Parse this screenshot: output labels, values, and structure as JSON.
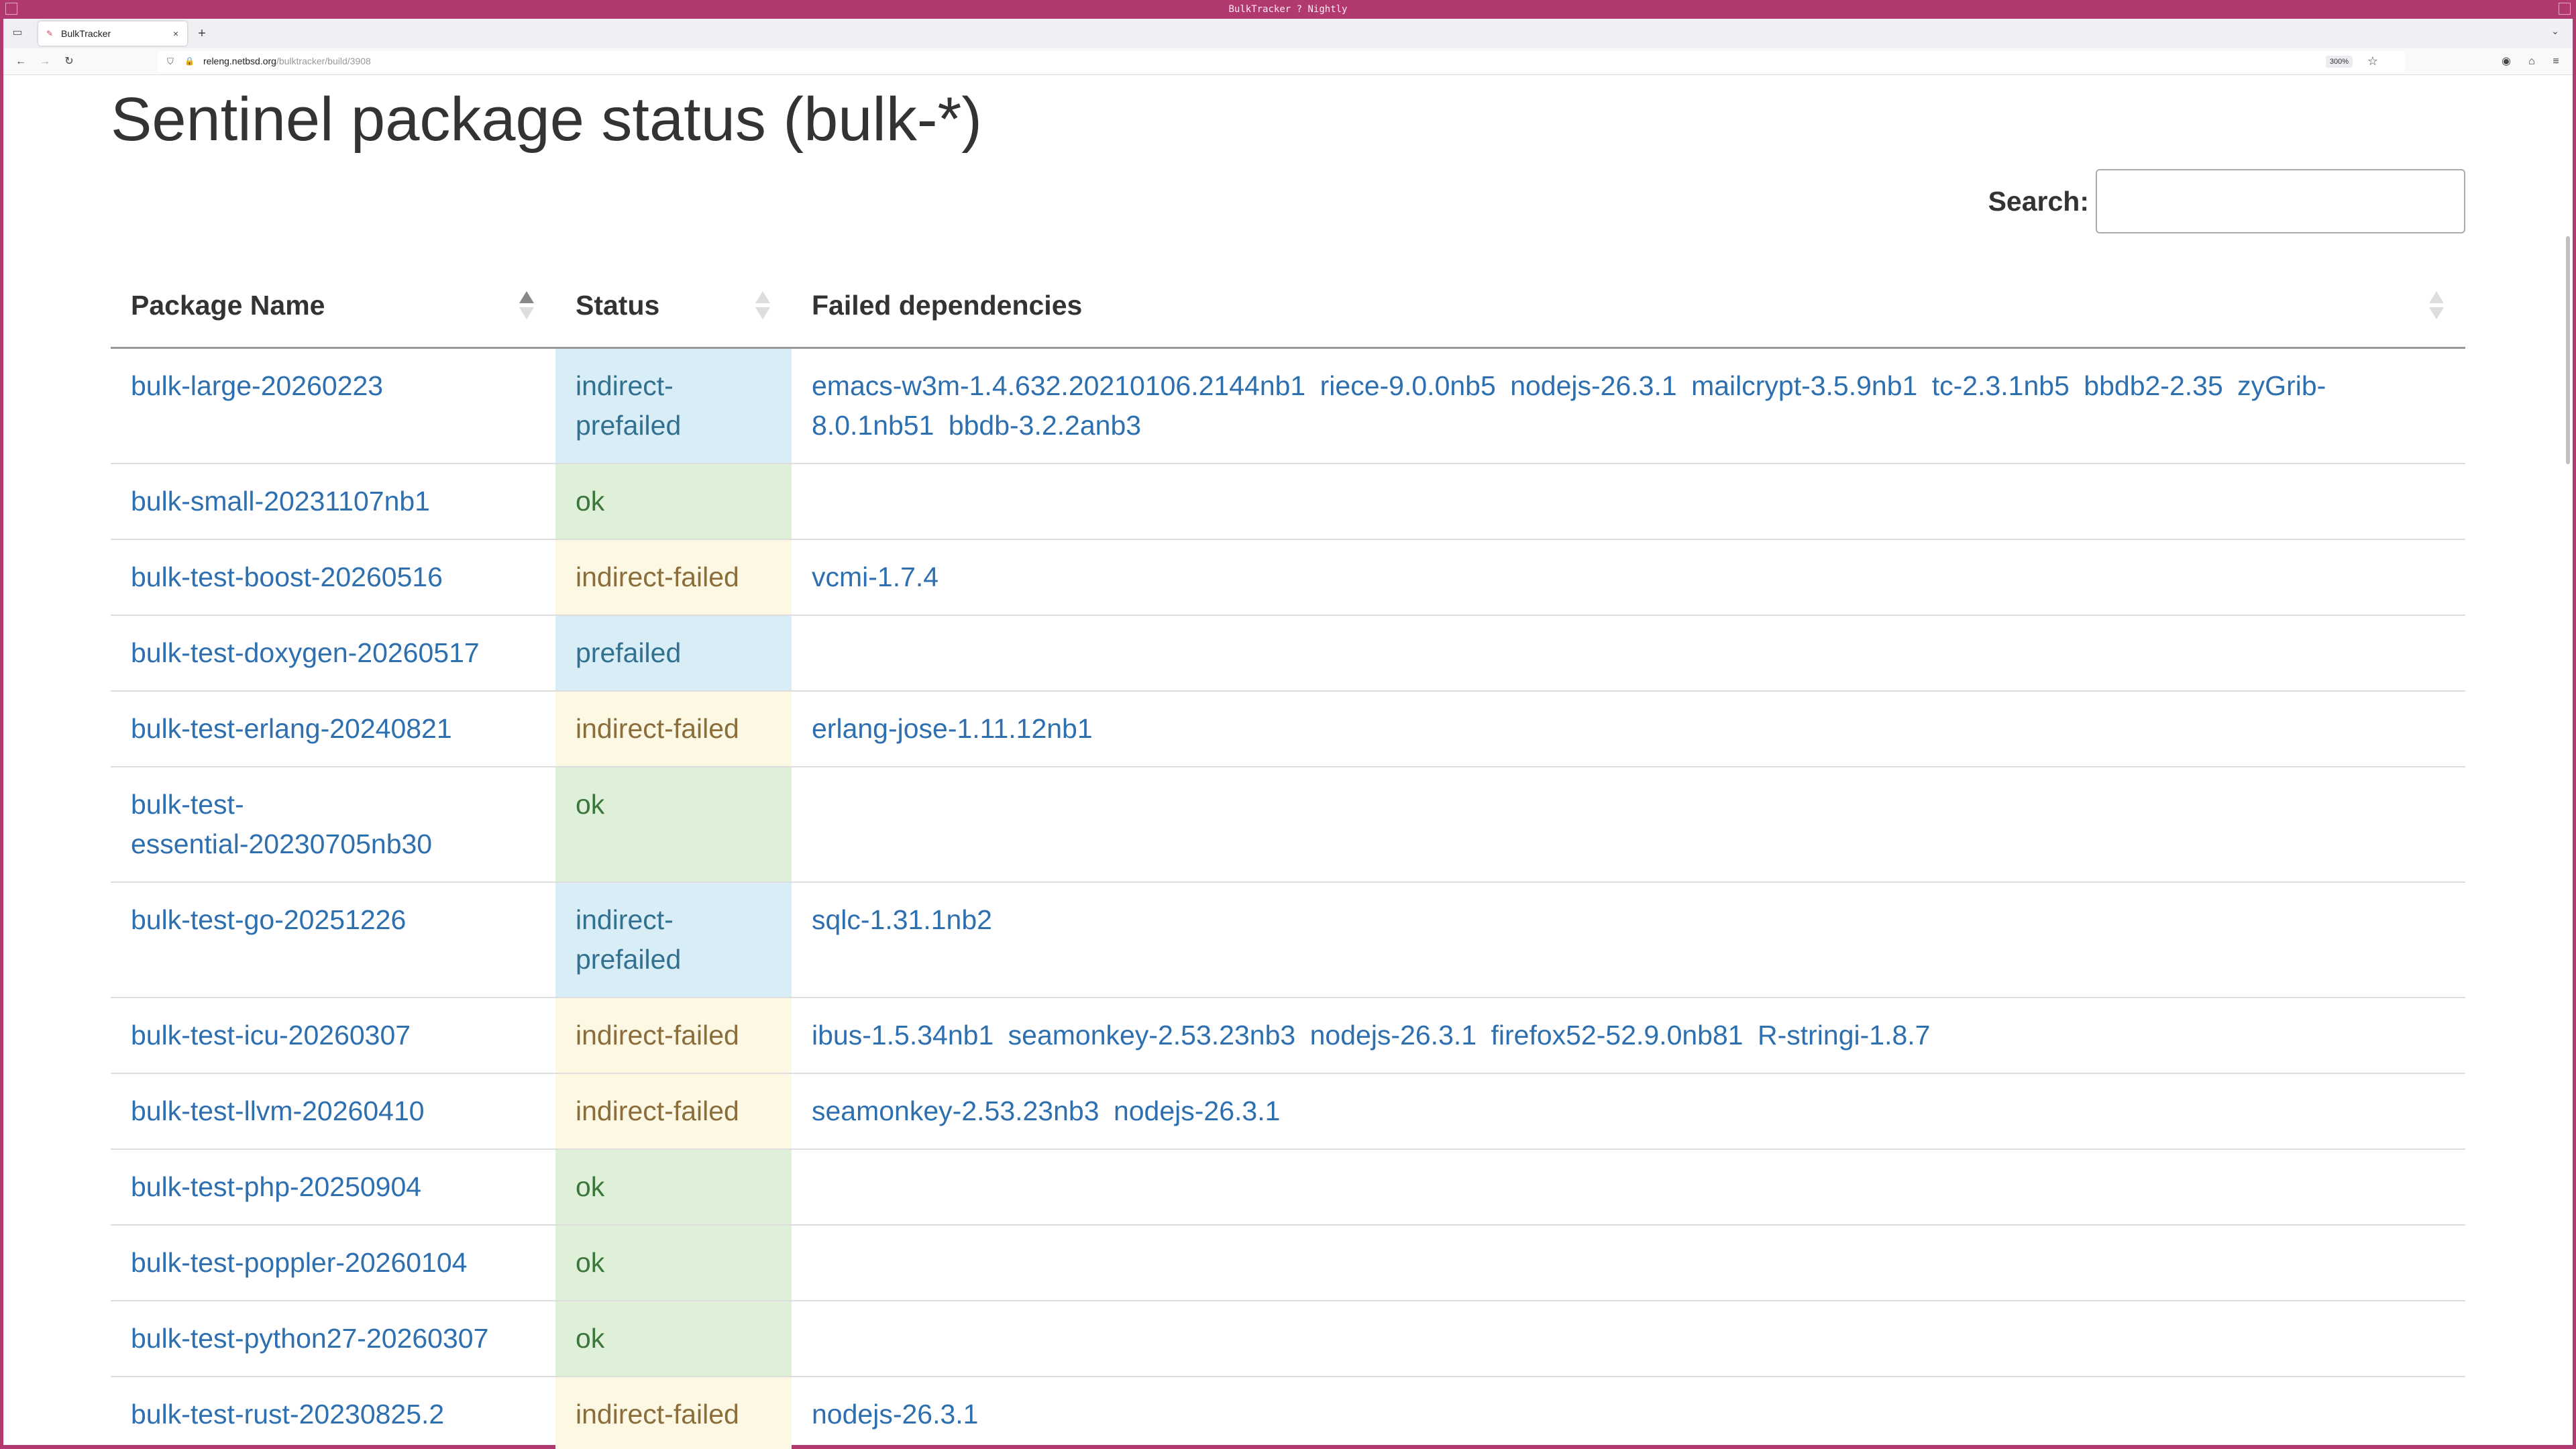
{
  "window": {
    "title": "BulkTracker ? Nightly"
  },
  "browser": {
    "tab_title": "BulkTracker",
    "url_domain": "releng.netbsd.org",
    "url_prefix": "",
    "url_path": "/bulktracker/build/3908",
    "zoom": "300%"
  },
  "page": {
    "title": "Sentinel package status (bulk-*)",
    "search_label": "Search:",
    "search_value": ""
  },
  "table": {
    "headers": [
      "Package Name",
      "Status",
      "Failed dependencies"
    ],
    "rows": [
      {
        "name": "bulk-large-20260223",
        "status": "indirect-prefailed",
        "deps": [
          "emacs-w3m-1.4.632.20210106.2144nb1",
          "riece-9.0.0nb5",
          "nodejs-26.3.1",
          "mailcrypt-3.5.9nb1",
          "tc-2.3.1nb5",
          "bbdb2-2.35",
          "zyGrib-8.0.1nb51",
          "bbdb-3.2.2anb3"
        ]
      },
      {
        "name": "bulk-small-20231107nb1",
        "status": "ok",
        "deps": []
      },
      {
        "name": "bulk-test-boost-20260516",
        "status": "indirect-failed",
        "deps": [
          "vcmi-1.7.4"
        ]
      },
      {
        "name": "bulk-test-doxygen-20260517",
        "status": "prefailed",
        "deps": []
      },
      {
        "name": "bulk-test-erlang-20240821",
        "status": "indirect-failed",
        "deps": [
          "erlang-jose-1.11.12nb1"
        ]
      },
      {
        "name": "bulk-test-essential-20230705nb30",
        "status": "ok",
        "deps": []
      },
      {
        "name": "bulk-test-go-20251226",
        "status": "indirect-prefailed",
        "deps": [
          "sqlc-1.31.1nb2"
        ]
      },
      {
        "name": "bulk-test-icu-20260307",
        "status": "indirect-failed",
        "deps": [
          "ibus-1.5.34nb1",
          "seamonkey-2.53.23nb3",
          "nodejs-26.3.1",
          "firefox52-52.9.0nb81",
          "R-stringi-1.8.7"
        ]
      },
      {
        "name": "bulk-test-llvm-20260410",
        "status": "indirect-failed",
        "deps": [
          "seamonkey-2.53.23nb3",
          "nodejs-26.3.1"
        ]
      },
      {
        "name": "bulk-test-php-20250904",
        "status": "ok",
        "deps": []
      },
      {
        "name": "bulk-test-poppler-20260104",
        "status": "ok",
        "deps": []
      },
      {
        "name": "bulk-test-python27-20260307",
        "status": "ok",
        "deps": []
      },
      {
        "name": "bulk-test-rust-20230825.2",
        "status": "indirect-failed",
        "deps": [
          "nodejs-26.3.1"
        ]
      }
    ]
  },
  "colors": {
    "frame": "#b2396f",
    "link": "#2e6fb0",
    "ok_bg": "#dff0d8",
    "failed_bg": "#fcf8e3",
    "prefailed_bg": "#d9edf7"
  }
}
